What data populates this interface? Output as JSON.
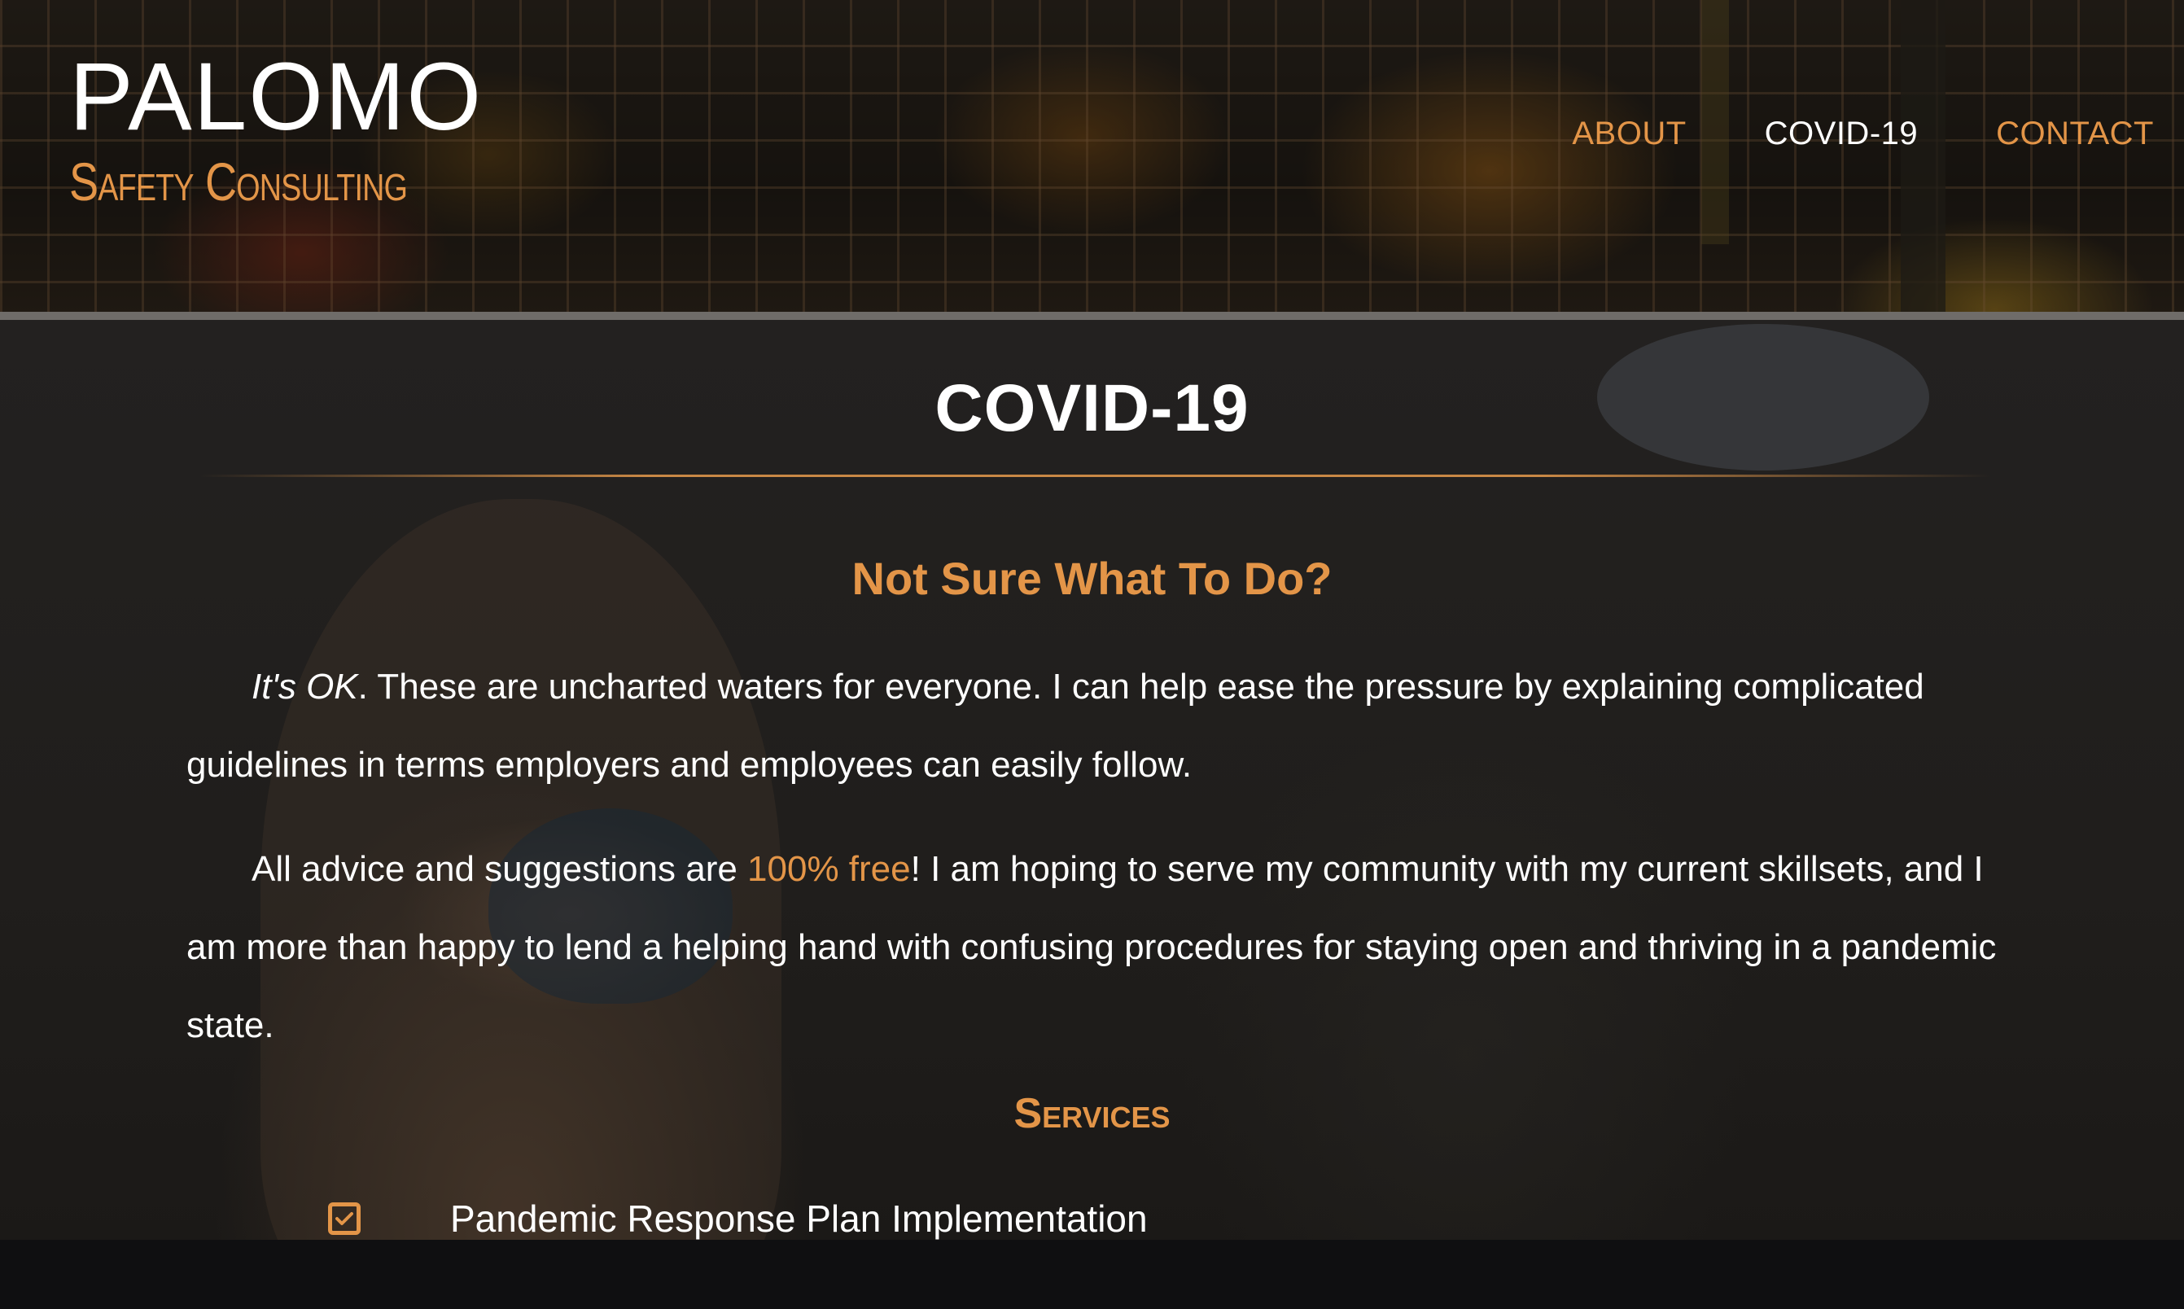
{
  "brand": {
    "title": "PALOMO",
    "subtitle": "Safety Consulting"
  },
  "nav": {
    "items": [
      {
        "label": "ABOUT"
      },
      {
        "label": "COVID-19"
      },
      {
        "label": "CONTACT"
      }
    ],
    "active": "COVID-19"
  },
  "main": {
    "title": "COVID-19",
    "subheading": "Not Sure What To Do?",
    "p1_emph": "It's OK",
    "p1_rest": ". These are uncharted waters for everyone. I can help ease the pressure by explaining complicated guidelines in terms employers and employees can easily follow.",
    "p2_start": "All advice and suggestions are ",
    "p2_accent": "100% free",
    "p2_rest": "! I am hoping to serve my community with my current skillsets, and I am more than happy to lend a helping hand with confusing procedures for staying open and thriving in a pandemic state.",
    "services_heading": "Services",
    "services": [
      {
        "label": "Pandemic Response Plan Implementation",
        "icon": "checkbox-checked-icon"
      }
    ]
  },
  "colors": {
    "accent": "#e39548",
    "text": "#ffffff",
    "background": "#1d1b19",
    "header_rule": "#6f6c69",
    "bottom_bar": "#0f0f11"
  }
}
